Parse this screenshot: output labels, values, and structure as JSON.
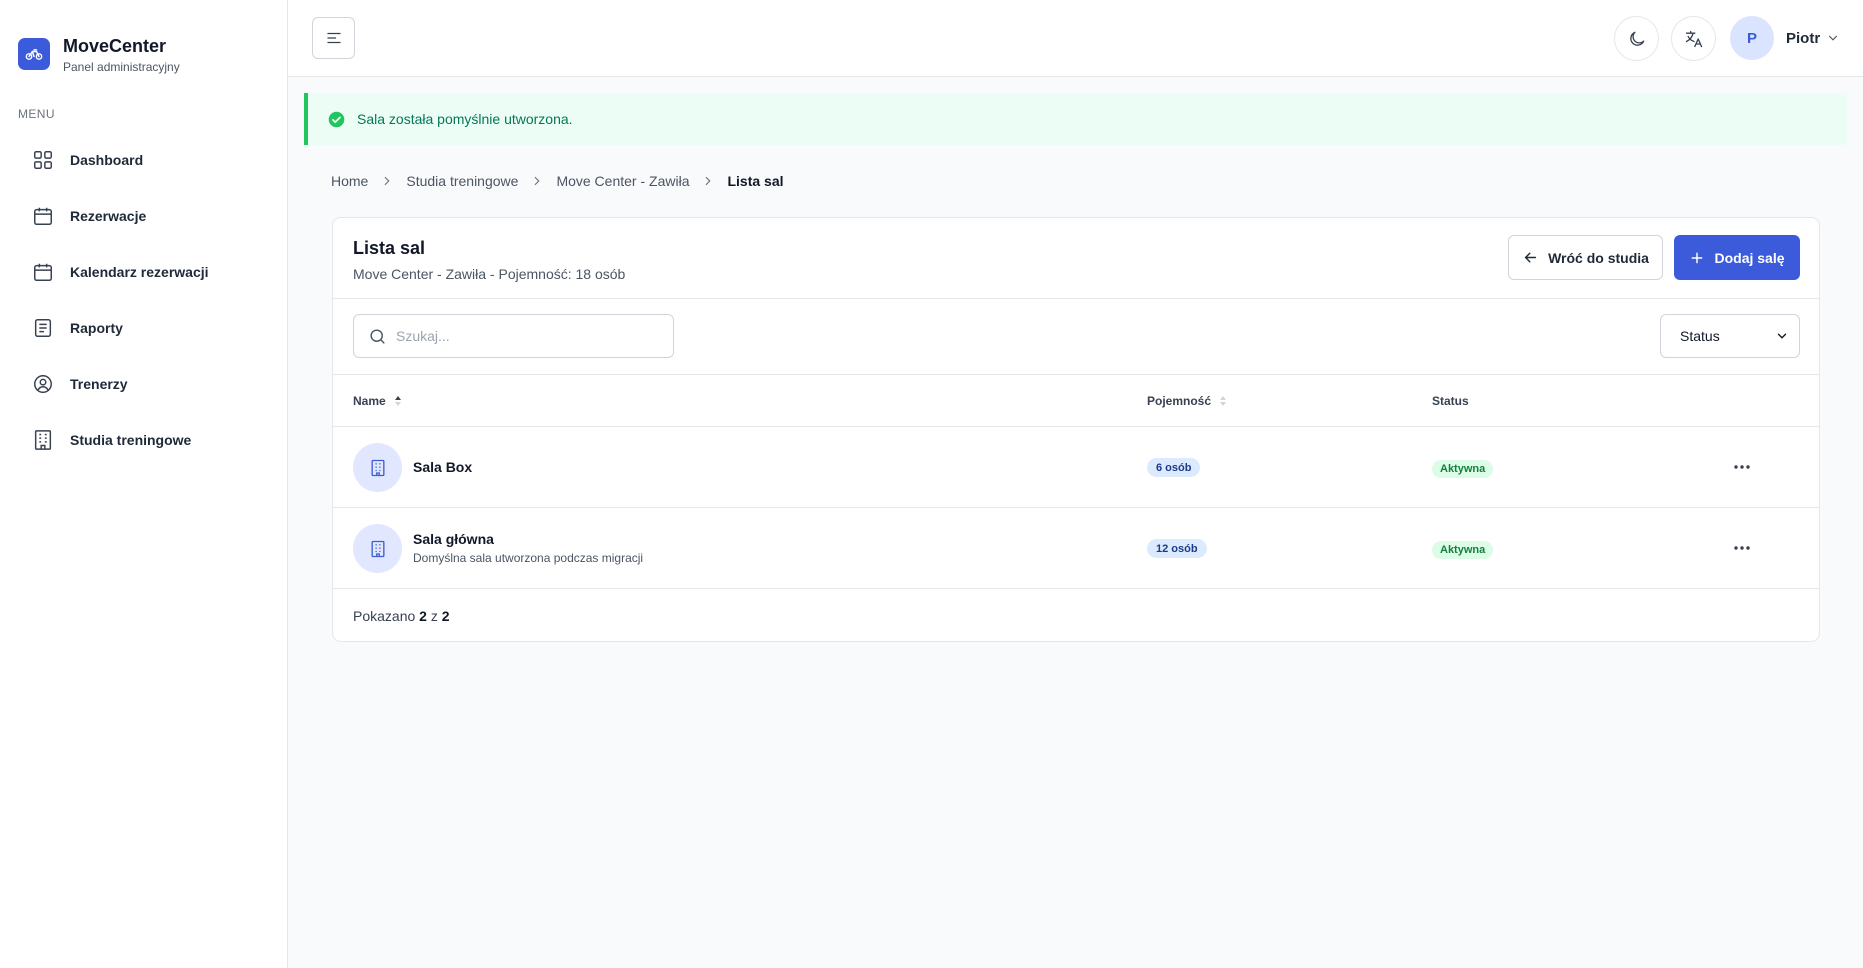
{
  "brand": {
    "title": "MoveCenter",
    "subtitle": "Panel administracyjny"
  },
  "sidebar": {
    "menu_heading": "MENU",
    "items": [
      {
        "label": "Dashboard",
        "icon": "grid-icon"
      },
      {
        "label": "Rezerwacje",
        "icon": "calendar-icon"
      },
      {
        "label": "Kalendarz rezerwacji",
        "icon": "calendar-icon"
      },
      {
        "label": "Raporty",
        "icon": "report-icon"
      },
      {
        "label": "Trenerzy",
        "icon": "user-circle-icon"
      },
      {
        "label": "Studia treningowe",
        "icon": "building-icon"
      }
    ]
  },
  "topbar": {
    "user_initial": "P",
    "user_name": "Piotr"
  },
  "alert": {
    "message": "Sala została pomyślnie utworzona."
  },
  "breadcrumb": [
    "Home",
    "Studia treningowe",
    "Move Center - Zawiła",
    "Lista sal"
  ],
  "card": {
    "title": "Lista sal",
    "subtitle": "Move Center - Zawiła - Pojemność: 18 osób",
    "back_label": "Wróć do studia",
    "add_label": "Dodaj salę",
    "search_placeholder": "Szukaj...",
    "status_filter": "Status"
  },
  "table": {
    "columns": {
      "name": "Name",
      "capacity": "Pojemność",
      "status": "Status"
    },
    "rows": [
      {
        "name": "Sala Box",
        "description": "",
        "capacity": "6 osób",
        "status": "Aktywna"
      },
      {
        "name": "Sala główna",
        "description": "Domyślna sala utworzona podczas migracji",
        "capacity": "12 osób",
        "status": "Aktywna"
      }
    ]
  },
  "footer": {
    "prefix": "Pokazano",
    "shown": "2",
    "of": "z",
    "total": "2"
  },
  "colors": {
    "primary": "#3b5bdb",
    "success": "#22c55e",
    "success_bg": "#ecfdf5"
  }
}
